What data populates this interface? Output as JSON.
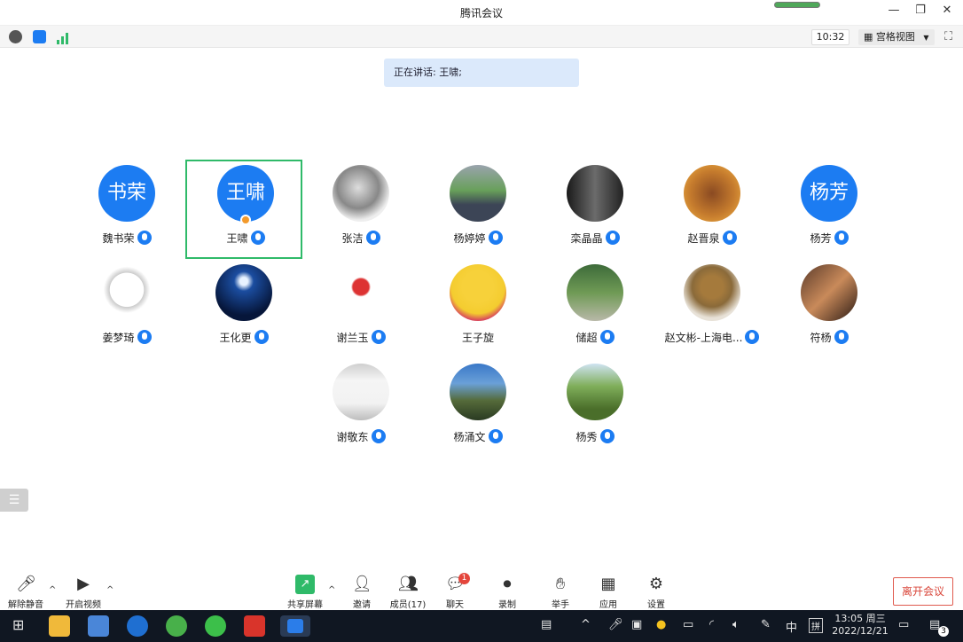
{
  "window": {
    "title": "腾讯会议"
  },
  "toolbar": {
    "clock": "10:32",
    "view_label": "宫格视图"
  },
  "speaking_banner": "正在讲话: 王啸;",
  "participants": [
    {
      "name": "魏书荣",
      "avatar_text": "书荣"
    },
    {
      "name": "王啸",
      "avatar_text": "王啸"
    },
    {
      "name": "张洁"
    },
    {
      "name": "杨婷婷"
    },
    {
      "name": "栾晶晶"
    },
    {
      "name": "赵晋泉"
    },
    {
      "name": "杨芳",
      "avatar_text": "杨芳"
    },
    {
      "name": "姜梦琦"
    },
    {
      "name": "王化更"
    },
    {
      "name": "谢兰玉"
    },
    {
      "name": "王子旋"
    },
    {
      "name": "储超"
    },
    {
      "name": "赵文彬-上海电..."
    },
    {
      "name": "符杨"
    },
    {
      "name": "谢敬东"
    },
    {
      "name": "杨涌文"
    },
    {
      "name": "杨秀"
    }
  ],
  "controls": {
    "unmute": "解除静音",
    "start_video": "开启视频",
    "share_screen": "共享屏幕",
    "invite": "邀请",
    "members": "成员(17)",
    "chat": "聊天",
    "chat_badge": "1",
    "record": "录制",
    "raise_hand": "举手",
    "apps": "应用",
    "settings": "设置",
    "leave": "离开会议"
  },
  "taskbar": {
    "ime_lang": "中",
    "ime_mode": "拼",
    "time": "13:05 周三",
    "date": "2022/12/21",
    "notif_count": "3"
  },
  "colors": {
    "accent": "#1c7cf2",
    "active_border": "#2fba69",
    "leave": "#d9463a",
    "taskbar": "#101722"
  }
}
